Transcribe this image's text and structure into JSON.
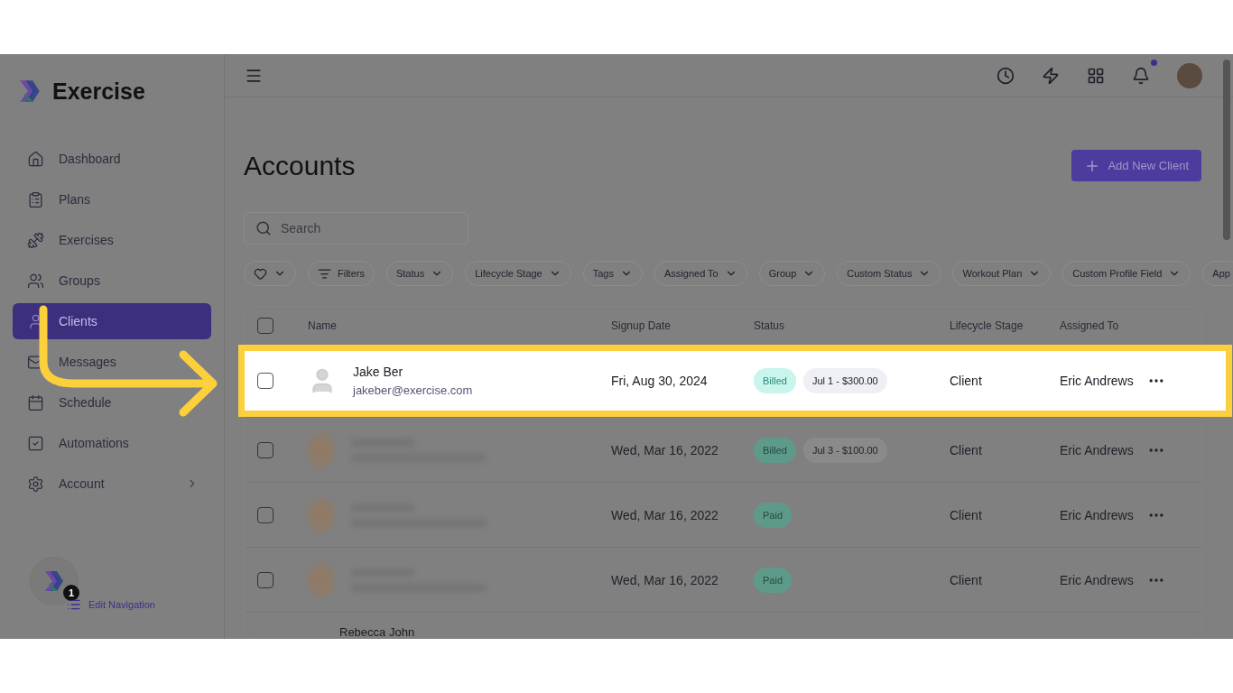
{
  "app": {
    "name": "Exercise"
  },
  "sidebar": {
    "items": [
      {
        "label": "Dashboard",
        "selected": false,
        "has_submenu": false
      },
      {
        "label": "Plans",
        "selected": false,
        "has_submenu": false
      },
      {
        "label": "Exercises",
        "selected": false,
        "has_submenu": false
      },
      {
        "label": "Groups",
        "selected": false,
        "has_submenu": false
      },
      {
        "label": "Clients",
        "selected": true,
        "has_submenu": false
      },
      {
        "label": "Messages",
        "selected": false,
        "has_submenu": false
      },
      {
        "label": "Schedule",
        "selected": false,
        "has_submenu": false
      },
      {
        "label": "Automations",
        "selected": false,
        "has_submenu": false
      },
      {
        "label": "Account",
        "selected": false,
        "has_submenu": true
      }
    ],
    "edit_navigation": {
      "label": "Edit Navigation",
      "badge": "1"
    }
  },
  "header": {
    "notifications_unread": true
  },
  "page": {
    "title": "Accounts",
    "add_button": "Add New Client",
    "search": {
      "placeholder": "Search"
    },
    "filters": [
      {
        "kind": "favorite"
      },
      {
        "kind": "filter",
        "label": "Filters"
      },
      {
        "kind": "dropdown",
        "label": "Status"
      },
      {
        "kind": "dropdown",
        "label": "Lifecycle Stage"
      },
      {
        "kind": "dropdown",
        "label": "Tags"
      },
      {
        "kind": "dropdown",
        "label": "Assigned To"
      },
      {
        "kind": "dropdown",
        "label": "Group"
      },
      {
        "kind": "dropdown",
        "label": "Custom Status"
      },
      {
        "kind": "dropdown",
        "label": "Workout Plan"
      },
      {
        "kind": "dropdown",
        "label": "Custom Profile Field"
      },
      {
        "kind": "plain",
        "label": "App"
      }
    ]
  },
  "table": {
    "all_selected": false,
    "columns": [
      "Name",
      "Signup Date",
      "Status",
      "Lifecycle Stage",
      "Assigned To"
    ],
    "rows": [
      {
        "kind": "full",
        "highlighted": true,
        "blurred": false,
        "selected": false,
        "name": "Jake Ber",
        "email": "jakeber@exercise.com",
        "signup": "Fri, Aug 30, 2024",
        "status": "Billed",
        "invoice": "Jul 1 - $300.00",
        "stage": "Client",
        "assigned": "Eric Andrews"
      },
      {
        "kind": "full",
        "highlighted": false,
        "blurred": true,
        "selected": false,
        "signup": "Wed, Mar 16, 2022",
        "status": "Billed",
        "invoice": "Jul 3 - $100.00",
        "stage": "Client",
        "assigned": "Eric Andrews"
      },
      {
        "kind": "full",
        "highlighted": false,
        "blurred": true,
        "selected": false,
        "signup": "Wed, Mar 16, 2022",
        "status": "Paid",
        "stage": "Client",
        "assigned": "Eric Andrews"
      },
      {
        "kind": "full",
        "highlighted": false,
        "blurred": true,
        "selected": false,
        "signup": "Wed, Mar 16, 2022",
        "status": "Paid",
        "stage": "Client",
        "assigned": "Eric Andrews"
      },
      {
        "kind": "partial",
        "name": "Rebecca John"
      }
    ]
  }
}
